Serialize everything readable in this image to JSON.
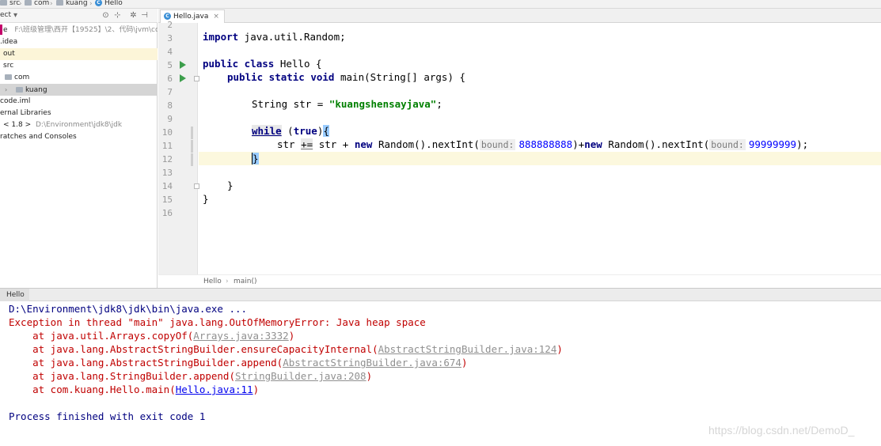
{
  "breadcrumb": {
    "items": [
      "src",
      "com",
      "kuang",
      "Hello"
    ]
  },
  "project": {
    "toolbar_label": "ect",
    "tree": [
      {
        "label": "e",
        "hint": "F:\\班级管理\\西开【19525】\\2、代码\\jvm\\code",
        "icon": "folder-icon"
      },
      {
        "label": ".idea",
        "hint": "",
        "icon": "folder-icon"
      },
      {
        "label": "out",
        "hint": "",
        "icon": "folder-orange-icon"
      },
      {
        "label": "src",
        "hint": "",
        "icon": "folder-blue-icon"
      },
      {
        "label": "com",
        "hint": "",
        "icon": "package-icon"
      },
      {
        "label": "kuang",
        "hint": "",
        "icon": "package-icon"
      },
      {
        "label": "code.iml",
        "hint": "",
        "icon": "file-icon"
      },
      {
        "label": "ernal Libraries",
        "hint": "",
        "icon": "library-icon"
      },
      {
        "label": "< 1.8 >",
        "hint": "D:\\Environment\\jdk8\\jdk",
        "icon": "jdk-icon"
      },
      {
        "label": "ratches and Consoles",
        "hint": "",
        "icon": "scratch-icon"
      }
    ]
  },
  "editor": {
    "tab_label": "Hello.java",
    "line_numbers": [
      "2",
      "3",
      "4",
      "5",
      "6",
      "7",
      "8",
      "9",
      "10",
      "11",
      "12",
      "13",
      "14",
      "15",
      "16"
    ],
    "lines": {
      "l3_kw": "import",
      "l3_rest": " java.util.Random;",
      "l5_kw": "public class",
      "l5_rest": " Hello {",
      "l6_kw": "public static void",
      "l6_rest": " main(String[] args) {",
      "l8_pre": "String str = ",
      "l8_str": "\"kuangshensayjava\"",
      "l8_post": ";",
      "l10_kw": "while",
      "l10_mid": " (",
      "l10_true": "true",
      "l10_close": ")",
      "l10_brace": "{",
      "l11_a": "str ",
      "l11_op": "+=",
      "l11_b": " str + ",
      "l11_new1": "new",
      "l11_c": " Random().nextInt(",
      "l11_hint1": "bound:",
      "l11_num1": "888888888",
      "l11_d": ")+",
      "l11_new2": "new",
      "l11_e": " Random().nextInt(",
      "l11_hint2": "bound:",
      "l11_num2": "99999999",
      "l11_f": ");",
      "l12_brace": "}",
      "l14": "}",
      "l15": "}"
    },
    "crumbs": [
      "Hello",
      "main()"
    ]
  },
  "run": {
    "tab_label": "Hello",
    "cmd": "D:\\Environment\\jdk8\\jdk\\bin\\java.exe ...",
    "exception": "Exception in thread \"main\" java.lang.OutOfMemoryError: Java heap space",
    "stack": [
      {
        "prefix": "    at java.util.Arrays.copyOf(",
        "link": "Arrays.java:3332",
        "suffix": ")"
      },
      {
        "prefix": "    at java.lang.AbstractStringBuilder.ensureCapacityInternal(",
        "link": "AbstractStringBuilder.java:124",
        "suffix": ")"
      },
      {
        "prefix": "    at java.lang.AbstractStringBuilder.append(",
        "link": "AbstractStringBuilder.java:674",
        "suffix": ")"
      },
      {
        "prefix": "    at java.lang.StringBuilder.append(",
        "link": "StringBuilder.java:208",
        "suffix": ")"
      },
      {
        "prefix": "    at com.kuang.Hello.main(",
        "link": "Hello.java:11",
        "suffix": ")"
      }
    ],
    "finished": "Process finished with exit code 1"
  },
  "watermark": "https://blog.csdn.net/DemoD_"
}
